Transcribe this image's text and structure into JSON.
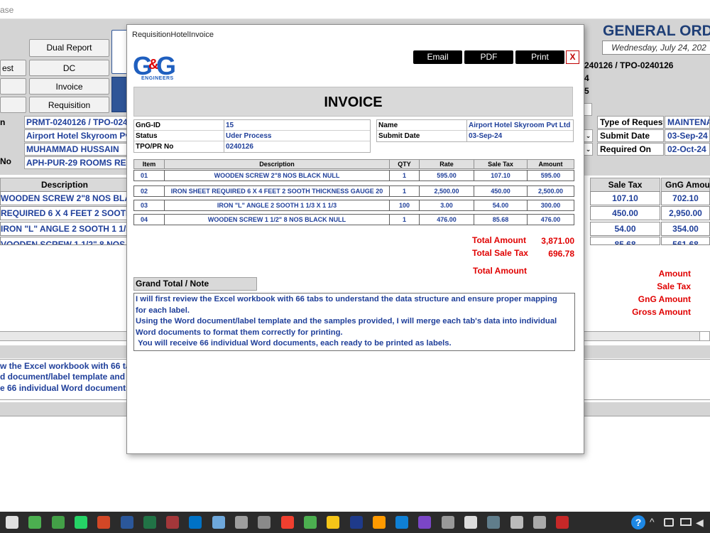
{
  "background_app": {
    "title_fragment": "ase",
    "nav_buttons": [
      "Dual Report",
      "DC",
      "Invoice",
      "Requisition"
    ],
    "left_button_fragment": "est",
    "header_title": "GENERAL ORD",
    "header_date": "Wednesday, July 24, 202",
    "ref_line": "240126 / TPO-0240126",
    "ref_4": "4",
    "ref_5": "5",
    "left_labels": [
      "n",
      "No"
    ],
    "left_values": [
      "PRMT-0240126 / TPO-024",
      "Airport Hotel Skyroom Pvt",
      "MUHAMMAD HUSSAIN",
      "APH-PUR-29 ROOMS RENO"
    ],
    "right_labels": [
      "Type of Request",
      "Submit Date",
      "Required On"
    ],
    "right_values": [
      "MAINTENAN",
      "03-Sep-24",
      "02-Oct-24"
    ],
    "grid_headers": {
      "description": "Description",
      "sale_tax": "Sale Tax",
      "gng_amount": "GnG Amoun"
    },
    "grid_rows": [
      {
        "desc": " WOODEN SCREW 2\"8 NOS BLACK",
        "tax": "107.10",
        "amount": "702.10"
      },
      {
        "desc": "REQUIRED 6 X 4 FEET 2 SOOTH TH",
        "tax": "450.00",
        "amount": "2,950.00"
      },
      {
        "desc": " IRON  \"L\" ANGLE 2 SOOTH 1 1/3 X",
        "tax": "54.00",
        "amount": "354.00"
      },
      {
        "desc": "VOODEN SCREW 1 1/2\" 8 NOS BLA",
        "tax": "85.68",
        "amount": "561.68"
      }
    ],
    "summary_labels": [
      "Amount",
      "Sale Tax",
      "GnG Amount",
      "Gross Amount"
    ],
    "note_fragments": [
      "w the Excel workbook with 66 tabs",
      "d document/label template and th",
      "e 66 individual Word documents,"
    ]
  },
  "dialog": {
    "title": "RequisitionHotelInvoice",
    "logo_text": "G&G",
    "logo_sub": "ENGINEERS",
    "buttons": {
      "email": "Email",
      "pdf": "PDF",
      "print": "Print",
      "close": "X"
    },
    "heading": "INVOICE",
    "info_left": [
      {
        "label": "GnG-ID",
        "value": "15"
      },
      {
        "label": "Status",
        "value": "Uder Process"
      },
      {
        "label": "TPO/PR No",
        "value": "0240126"
      }
    ],
    "info_right": [
      {
        "label": "Name",
        "value": "Airport Hotel Skyroom Pvt Ltd"
      },
      {
        "label": "Submit Date",
        "value": "03-Sep-24"
      }
    ],
    "table": {
      "headers": {
        "item": "Item",
        "description": "Description",
        "qty": "QTY",
        "rate": "Rate",
        "sale_tax": "Sale Tax",
        "amount": "Amount"
      },
      "rows": [
        {
          "item": "01",
          "description": "WOODEN SCREW 2\"8 NOS BLACK NULL",
          "qty": "1",
          "rate": "595.00",
          "sale_tax": "107.10",
          "amount": "595.00"
        },
        {
          "item": "02",
          "description": "IRON SHEET REQUIRED 6 X 4 FEET 2 SOOTH THICKNESS GAUGE 20",
          "qty": "1",
          "rate": "2,500.00",
          "sale_tax": "450.00",
          "amount": "2,500.00"
        },
        {
          "item": "03",
          "description": "IRON  \"L\" ANGLE 2 SOOTH 1 1/3 X 1 1/3",
          "qty": "100",
          "rate": "3.00",
          "sale_tax": "54.00",
          "amount": "300.00"
        },
        {
          "item": "04",
          "description": "WOODEN SCREW 1 1/2\" 8 NOS BLACK NULL",
          "qty": "1",
          "rate": "476.00",
          "sale_tax": "85.68",
          "amount": "476.00"
        }
      ]
    },
    "totals": {
      "total_amount_label": "Total Amount",
      "total_amount_value": "3,871.00",
      "total_sale_tax_label": "Total Sale Tax",
      "total_sale_tax_value": "696.78",
      "grand_total_amount_label": "Total Amount"
    },
    "grand_total_label": "Grand Total / Note",
    "note_text": "I will first review the Excel workbook with 66 tabs to understand the data structure and ensure proper mapping\nfor each label.\nUsing the Word document/label template and the samples provided, I will merge each tab's data into individual\nWord documents to format them correctly for printing.\n You will receive 66 individual Word documents, each ready to be printed as labels."
  },
  "colors": {
    "accent_blue": "#1f3f9a",
    "header_navy": "#1f3f77",
    "total_red": "#e00000",
    "button_black": "#000000",
    "taskbar": "#2b2b2b"
  },
  "taskbar_icons": [
    "chrome-icon",
    "chrome-icon",
    "android-icon",
    "whatsapp-icon",
    "powerpoint-icon",
    "word-icon",
    "excel-icon",
    "access-icon",
    "outlook-icon",
    "notepad-icon",
    "calculator-icon",
    "app-icon",
    "anydesk-icon",
    "chrome-icon",
    "explorer-icon",
    "photoshop-icon",
    "illustrator-icon",
    "vscode-icon",
    "visual-studio-icon",
    "app-icon",
    "capcut-icon",
    "monitor-icon",
    "app-icon",
    "app-icon",
    "download-icon"
  ]
}
